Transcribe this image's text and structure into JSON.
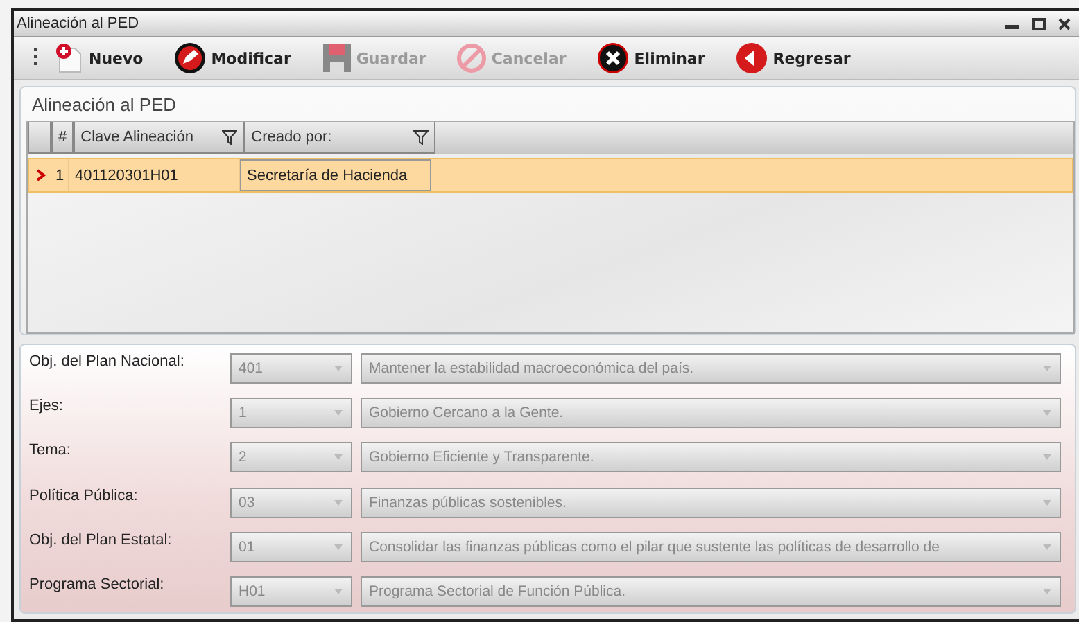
{
  "window": {
    "title": "Alineación al PED"
  },
  "toolbar": [
    {
      "kind": "new",
      "label": "Nuevo",
      "disabled": false
    },
    {
      "kind": "edit",
      "label": "Modificar",
      "disabled": false
    },
    {
      "kind": "save",
      "label": "Guardar",
      "disabled": true
    },
    {
      "kind": "cancel",
      "label": "Cancelar",
      "disabled": true
    },
    {
      "kind": "delete",
      "label": "Eliminar",
      "disabled": false
    },
    {
      "kind": "back",
      "label": "Regresar",
      "disabled": false
    }
  ],
  "panel": {
    "title": "Alineación al PED"
  },
  "table": {
    "columns": [
      {
        "label": "#",
        "filter": false
      },
      {
        "label": "Clave Alineación",
        "filter": true
      },
      {
        "label": "Creado por:",
        "filter": true
      }
    ],
    "rows": [
      {
        "selected": true,
        "cells": [
          "1",
          "401120301H01",
          "Secretaría de Hacienda"
        ]
      }
    ]
  },
  "fields": [
    {
      "label": "Obj. del Plan Nacional:",
      "code": "401",
      "description": "Mantener la estabilidad macroeconómica del país."
    },
    {
      "label": "Ejes:",
      "code": "1",
      "description": "Gobierno Cercano a la Gente."
    },
    {
      "label": "Tema:",
      "code": "2",
      "description": "Gobierno Eficiente y Transparente."
    },
    {
      "label": "Política Pública:",
      "code": "03",
      "description": "Finanzas públicas sostenibles."
    },
    {
      "label": "Obj. del Plan Estatal:",
      "code": "01",
      "description": "Consolidar las finanzas públicas como el pilar que sustente las políticas de desarrollo de"
    },
    {
      "label": "Programa Sectorial:",
      "code": "H01",
      "description": "Programa Sectorial de Función Pública."
    }
  ]
}
